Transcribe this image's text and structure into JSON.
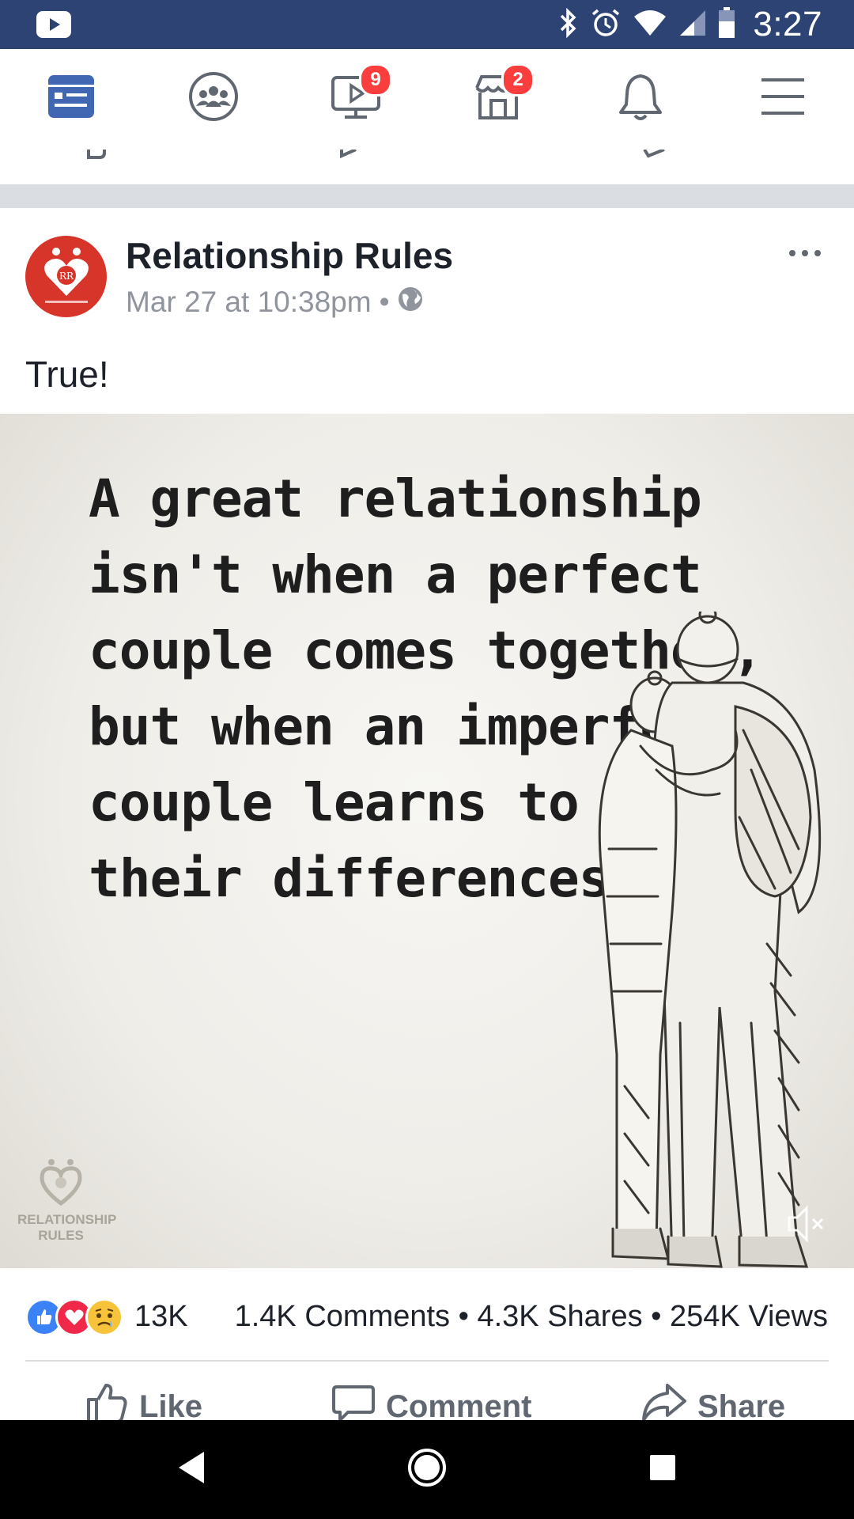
{
  "status_bar": {
    "time": "3:27",
    "icons": [
      "youtube-icon",
      "bluetooth-icon",
      "alarm-icon",
      "wifi-icon",
      "signal-icon",
      "battery-icon"
    ]
  },
  "top_nav": {
    "tabs": [
      {
        "name": "news-feed",
        "icon": "news-feed-icon",
        "badge": ""
      },
      {
        "name": "groups",
        "icon": "groups-icon",
        "badge": ""
      },
      {
        "name": "watch",
        "icon": "watch-video-icon",
        "badge": "9"
      },
      {
        "name": "marketplace",
        "icon": "marketplace-icon",
        "badge": "2"
      },
      {
        "name": "notifications",
        "icon": "bell-icon",
        "badge": ""
      },
      {
        "name": "menu",
        "icon": "hamburger-menu-icon",
        "badge": ""
      }
    ],
    "accent": "#4267b2",
    "badge_color": "#fa3e3e"
  },
  "post": {
    "page_name": "Relationship Rules",
    "timestamp": "Mar 27 at 10:38pm",
    "separator": "•",
    "privacy_icon": "globe-icon",
    "avatar_initials": "RR",
    "text": "True!",
    "image": {
      "quote": "A great relationship isn't when a perfect couple comes together, but when an imperfect couple learns to enjoy their differences.",
      "watermark_line1": "RELATIONSHIP",
      "watermark_line2": "RULES",
      "mute_icon": "muted-speaker-icon"
    }
  },
  "engagement": {
    "reactions": [
      "like-reaction-icon",
      "love-reaction-icon",
      "sad-reaction-icon"
    ],
    "reaction_count": "13K",
    "stats": "1.4K Comments • 4.3K Shares • 254K Views"
  },
  "actions": {
    "like": "Like",
    "comment": "Comment",
    "share": "Share"
  },
  "android_nav": [
    "back-icon",
    "home-icon",
    "recents-icon"
  ]
}
